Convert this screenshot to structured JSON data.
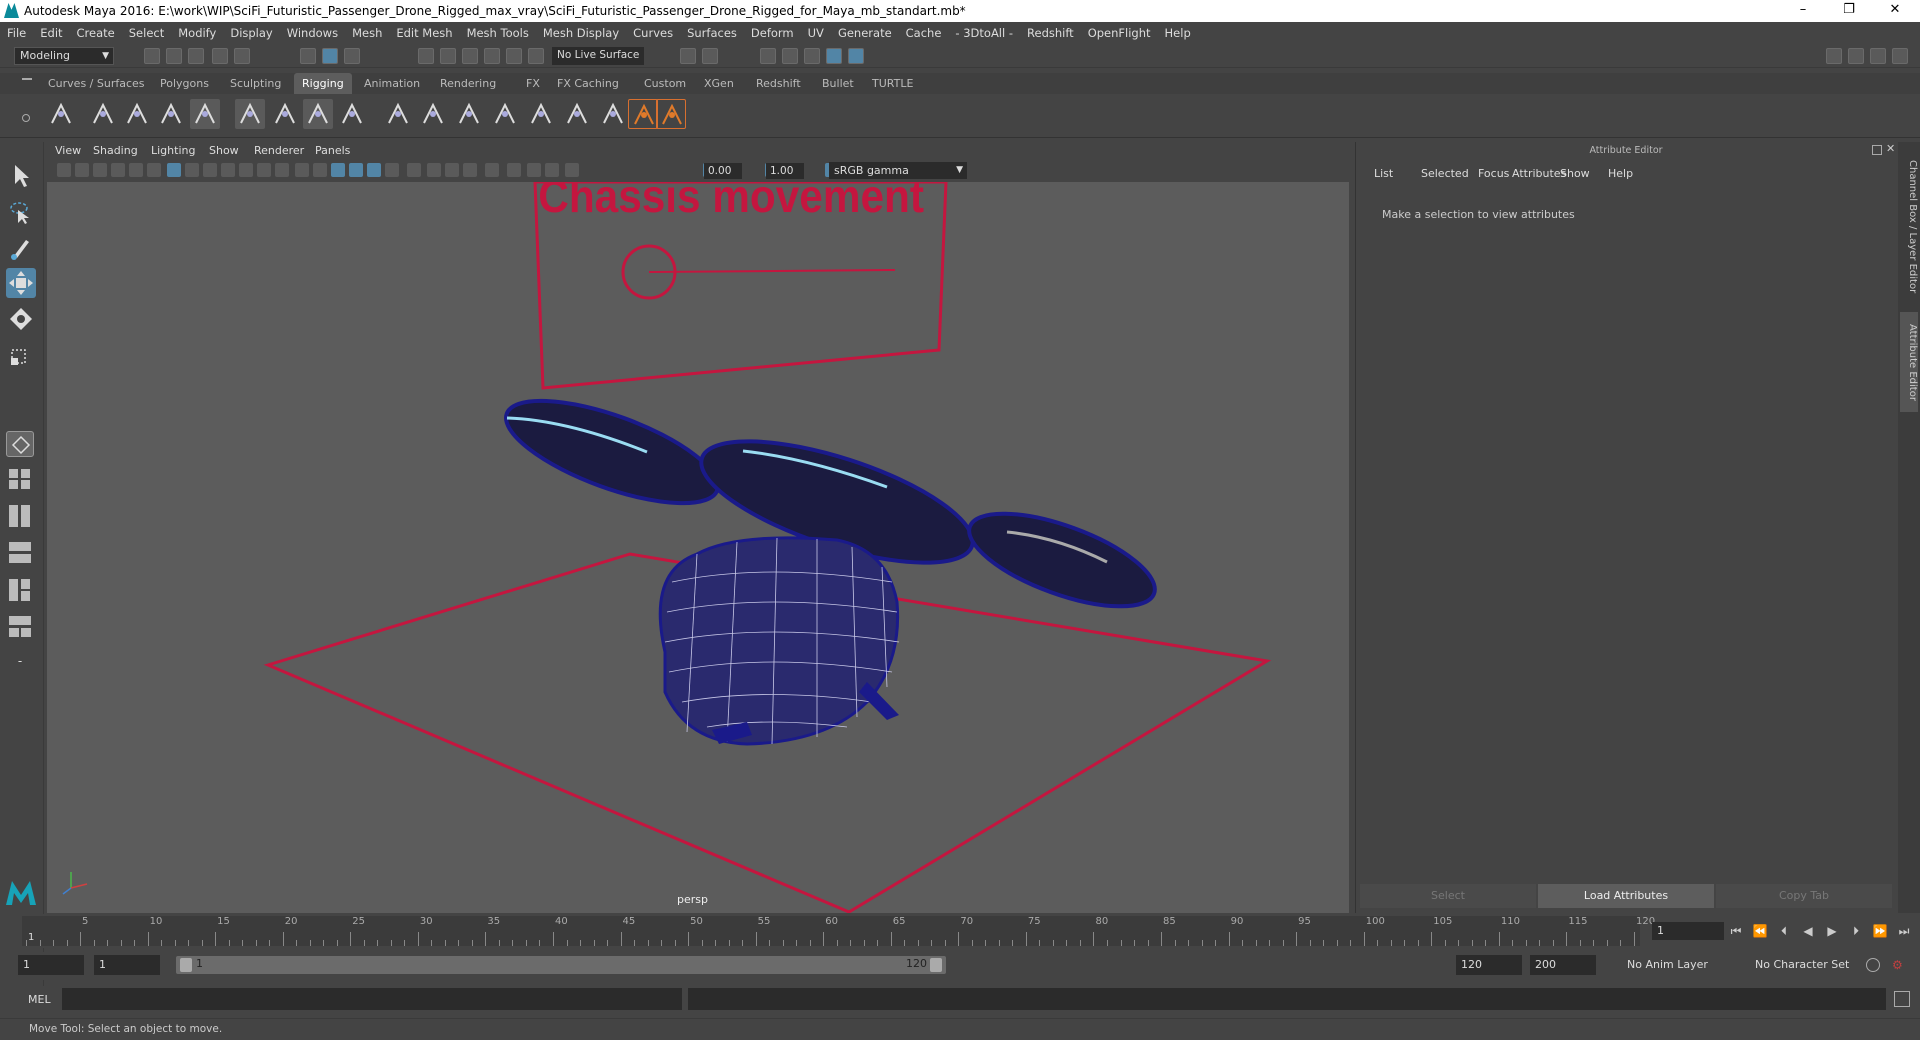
{
  "window": {
    "title": "Autodesk Maya 2016: E:\\work\\WIP\\SciFi_Futuristic_Passenger_Drone_Rigged_max_vray\\SciFi_Futuristic_Passenger_Drone_Rigged_for_Maya_mb_standart.mb*",
    "minimize": "–",
    "restore": "❐",
    "close": "✕"
  },
  "menubar": [
    "File",
    "Edit",
    "Create",
    "Select",
    "Modify",
    "Display",
    "Windows",
    "Mesh",
    "Edit Mesh",
    "Mesh Tools",
    "Mesh Display",
    "Curves",
    "Surfaces",
    "Deform",
    "UV",
    "Generate",
    "Cache",
    "- 3DtoAll -",
    "Redshift",
    "OpenFlight",
    "Help"
  ],
  "statusline": {
    "mode": "Modeling",
    "live_surface": "No Live Surface"
  },
  "shelf": {
    "tabs": [
      "Curves / Surfaces",
      "Polygons",
      "Sculpting",
      "Rigging",
      "Animation",
      "Rendering",
      "FX",
      "FX Caching",
      "Custom",
      "XGen",
      "Redshift",
      "Bullet",
      "TURTLE"
    ],
    "active_tab": "Rigging"
  },
  "viewport": {
    "menu": [
      "View",
      "Shading",
      "Lighting",
      "Show",
      "Renderer",
      "Panels"
    ],
    "exposure": "0.00",
    "gamma": "1.00",
    "color_space": "sRGB gamma",
    "camera_label": "persp",
    "scene_text": "Chassis movement"
  },
  "attribute_editor": {
    "header": "Attribute Editor",
    "menu": [
      "List",
      "Selected",
      "Focus",
      "Attributes",
      "Show",
      "Help"
    ],
    "message": "Make a selection to view attributes",
    "buttons": {
      "select": "Select",
      "load": "Load Attributes",
      "copy": "Copy Tab"
    }
  },
  "side_tabs": {
    "channel_box": "Channel Box / Layer Editor",
    "attribute_editor": "Attribute Editor"
  },
  "timeline": {
    "ticks": [
      "5",
      "10",
      "15",
      "20",
      "25",
      "30",
      "35",
      "40",
      "45",
      "50",
      "55",
      "60",
      "65",
      "70",
      "75",
      "80",
      "85",
      "90",
      "95",
      "100",
      "105",
      "110",
      "115",
      "120"
    ],
    "first_tick": "1",
    "current_frame": "1"
  },
  "range": {
    "start": "1",
    "playback_start": "1",
    "slider_start": "1",
    "slider_end": "120",
    "playback_end": "120",
    "end": "200",
    "anim_layer": "No Anim Layer",
    "character_set": "No Character Set"
  },
  "mel": {
    "label": "MEL"
  },
  "help_line": "Move Tool: Select an object to move.",
  "colors": {
    "accent": "#5285a6",
    "rig_red": "#c4163f",
    "wire_blue": "#1a1a8a"
  }
}
